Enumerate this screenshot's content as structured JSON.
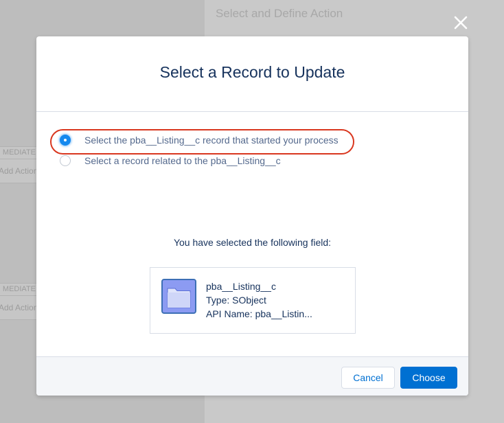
{
  "background": {
    "section_header": "Select and Define Action",
    "criteria_tag_1": "MEDIATE",
    "criteria_action_1": "Add Action",
    "criteria_tag_2": "MEDIATE",
    "criteria_action_2": "Add Action"
  },
  "modal": {
    "title": "Select a Record to Update",
    "options": [
      {
        "label": "Select the pba__Listing__c record that started your process",
        "selected": true
      },
      {
        "label": "Select a record related to the pba__Listing__c",
        "selected": false
      }
    ],
    "selected_caption": "You have selected the following field:",
    "field": {
      "icon": "folder-icon",
      "name": "pba__Listing__c",
      "type_line": "Type: SObject",
      "api_line": "API Name: pba__Listin..."
    },
    "footer": {
      "cancel_label": "Cancel",
      "choose_label": "Choose"
    },
    "close_icon": "close-icon"
  },
  "colors": {
    "brand_blue": "#0070d2",
    "radio_checked": "#1589ee",
    "highlight_ring": "#d9361e",
    "title_text": "#16325c",
    "body_text": "#54698d",
    "folder_fill": "#8c9bf2",
    "folder_border": "#3c6fb5"
  }
}
